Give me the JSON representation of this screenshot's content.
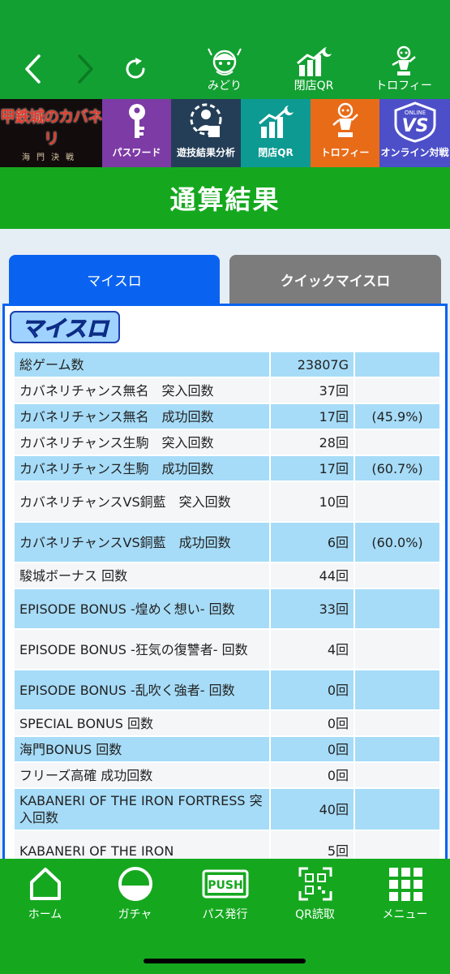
{
  "topnav": {
    "tabs": [
      {
        "label": "みどり",
        "icon": "character-icon"
      },
      {
        "label": "閉店QR",
        "icon": "closing-qr-icon"
      },
      {
        "label": "トロフィー",
        "icon": "trophy-icon"
      }
    ]
  },
  "banners": {
    "logo_title": "甲鉄城のカバネリ",
    "logo_sub": "海門決戦",
    "items": [
      {
        "label": "パスワード",
        "icon": "key-icon"
      },
      {
        "label": "遊技結果分析",
        "icon": "analysis-icon"
      },
      {
        "label": "閉店QR",
        "icon": "closing-qr-icon"
      },
      {
        "label": "トロフィー",
        "icon": "trophy-icon"
      },
      {
        "label": "オンライン対戦",
        "icon": "online-vs-icon"
      }
    ]
  },
  "page": {
    "title": "通算結果"
  },
  "tabs": [
    {
      "label": "マイスロ",
      "active": true
    },
    {
      "label": "クイックマイスロ",
      "active": false
    }
  ],
  "panel": {
    "logo_text": "マイスロ"
  },
  "results": [
    {
      "label": "総ゲーム数",
      "value": "23807G",
      "pct": ""
    },
    {
      "label": "カバネリチャンス無名　突入回数",
      "value": "37回",
      "pct": ""
    },
    {
      "label": "カバネリチャンス無名　成功回数",
      "value": "17回",
      "pct": "(45.9%)"
    },
    {
      "label": "カバネリチャンス生駒　突入回数",
      "value": "28回",
      "pct": ""
    },
    {
      "label": "カバネリチャンス生駒　成功回数",
      "value": "17回",
      "pct": "(60.7%)"
    },
    {
      "label": "カバネリチャンスVS銅藍　突入回数",
      "value": "10回",
      "pct": ""
    },
    {
      "label": "カバネリチャンスVS銅藍　成功回数",
      "value": "6回",
      "pct": "(60.0%)"
    },
    {
      "label": "駿城ボーナス 回数",
      "value": "44回",
      "pct": ""
    },
    {
      "label": "EPISODE BONUS -煌めく想い- 回数",
      "value": "33回",
      "pct": ""
    },
    {
      "label": "EPISODE BONUS -狂気の復讐者- 回数",
      "value": "4回",
      "pct": ""
    },
    {
      "label": "EPISODE BONUS -乱吹く強者- 回数",
      "value": "0回",
      "pct": ""
    },
    {
      "label": "SPECIAL BONUS 回数",
      "value": "0回",
      "pct": ""
    },
    {
      "label": "海門BONUS 回数",
      "value": "0回",
      "pct": ""
    },
    {
      "label": "フリーズ高確 成功回数",
      "value": "0回",
      "pct": ""
    },
    {
      "label": "KABANERI OF THE IRON FORTRESS 突入回数",
      "value": "40回",
      "pct": ""
    },
    {
      "label": "KABANERI OF THE IRON",
      "value": "5回",
      "pct": ""
    }
  ],
  "bottomnav": [
    {
      "label": "ホーム",
      "icon": "home-icon"
    },
    {
      "label": "ガチャ",
      "icon": "gacha-icon"
    },
    {
      "label": "パス発行",
      "icon": "push-pass-icon"
    },
    {
      "label": "QR読取",
      "icon": "qr-scan-icon"
    },
    {
      "label": "メニュー",
      "icon": "menu-grid-icon"
    }
  ],
  "colors": {
    "brand_green": "#15a81f",
    "tab_active": "#0a63f0",
    "tab_inactive": "#7c7c7c",
    "row_blue": "#a6dcf8"
  }
}
